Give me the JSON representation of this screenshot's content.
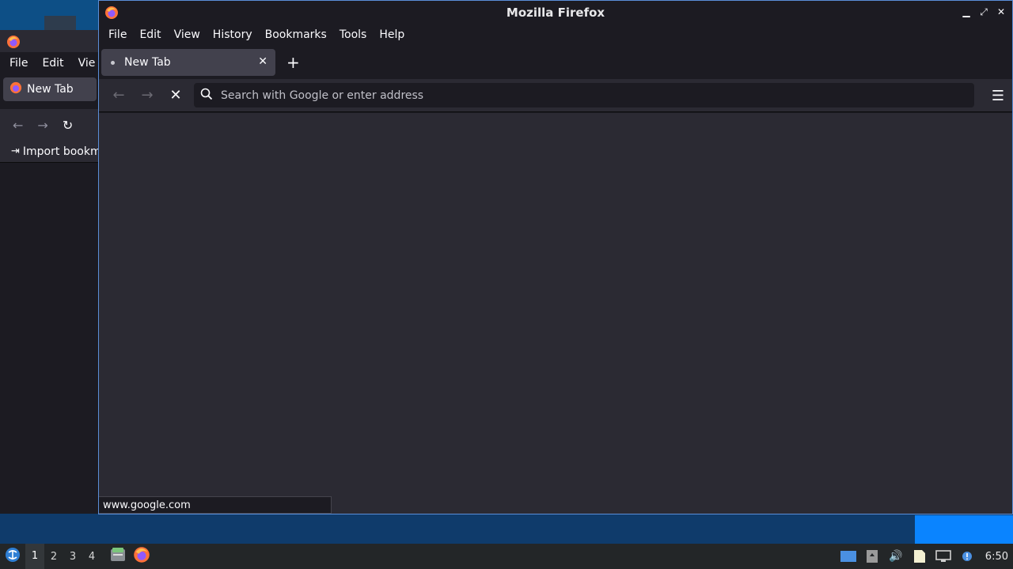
{
  "background_window": {
    "menu": [
      "File",
      "Edit",
      "Vie"
    ],
    "tab_label": "New Tab",
    "bookmark_item": "Import bookm"
  },
  "window": {
    "title": "Mozilla Firefox",
    "menu": {
      "file": "File",
      "edit": "Edit",
      "view": "View",
      "history": "History",
      "bookmarks": "Bookmarks",
      "tools": "Tools",
      "help": "Help"
    },
    "tab": {
      "label": "New Tab"
    },
    "urlbar": {
      "placeholder": "Search with Google or enter address"
    },
    "status": "www.google.com"
  },
  "taskbar": {
    "workspaces": [
      "1",
      "2",
      "3",
      "4"
    ],
    "current_workspace": "1",
    "clock": "6:50"
  },
  "colors": {
    "accent": "#0a84ff",
    "window_border": "#5b8ed8",
    "toolbar": "#2b2a33",
    "frame": "#1c1b22"
  }
}
